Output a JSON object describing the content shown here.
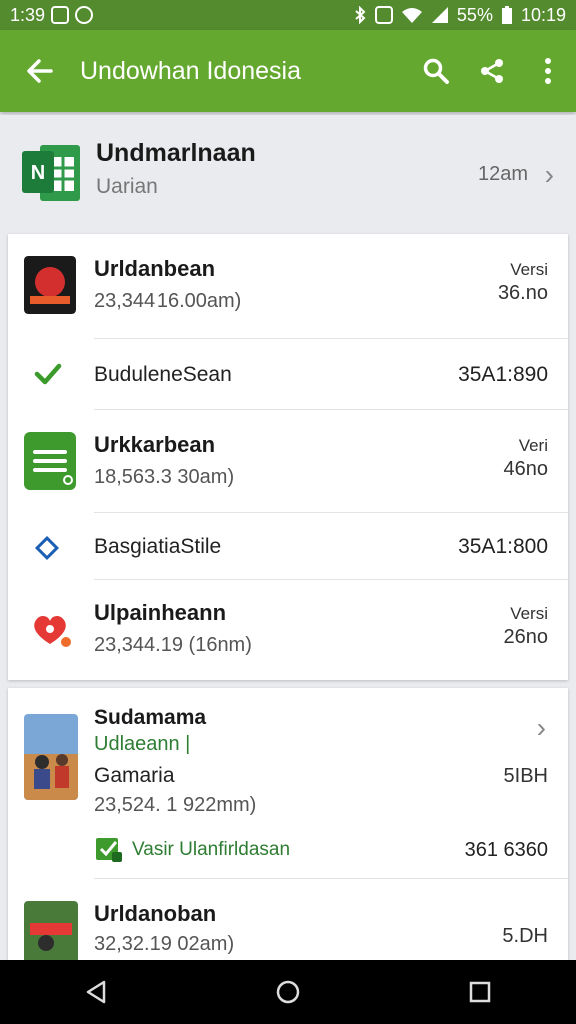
{
  "status_bar": {
    "time": "1:39",
    "battery_pct": "55%",
    "clock": "10:19"
  },
  "app_bar": {
    "title": "Undowhan Idonesia"
  },
  "summary": {
    "name": "Undmarlnaan",
    "subtitle": "Uarian",
    "time": "12am"
  },
  "items": [
    {
      "title": "Urldanbean",
      "subtitle": "23,344 16.00am)",
      "r1": "Versi",
      "r2": "36.no"
    },
    {
      "label": "BuduleneSean",
      "value": "35A1:890"
    },
    {
      "title": "Urkkarbean",
      "subtitle": "18,563.3 30am)",
      "r1": "Veri",
      "r2": "46no"
    },
    {
      "label": "BasgiatiaStile",
      "value": "35A1:800"
    },
    {
      "title": "Ulpainheann",
      "subtitle": "23,344.19 (16nm)",
      "r1": "Versi",
      "r2": "26no"
    }
  ],
  "card2": {
    "title": "Sudamama",
    "link": "Udlaeann |",
    "category": "Gamaria",
    "subtitle": "23,524. 1 922mm)",
    "size": "5IBH",
    "version_label": "Vasir Ulanfirldasan",
    "version_value": "361 6360",
    "item2_title": "Urldanoban",
    "item2_sub": "32,32.19 02am)",
    "item2_size": "5.DH"
  },
  "colors": {
    "statusbar": "#558b2f",
    "appbar": "#64a830",
    "accent_green": "#2e7d32"
  }
}
